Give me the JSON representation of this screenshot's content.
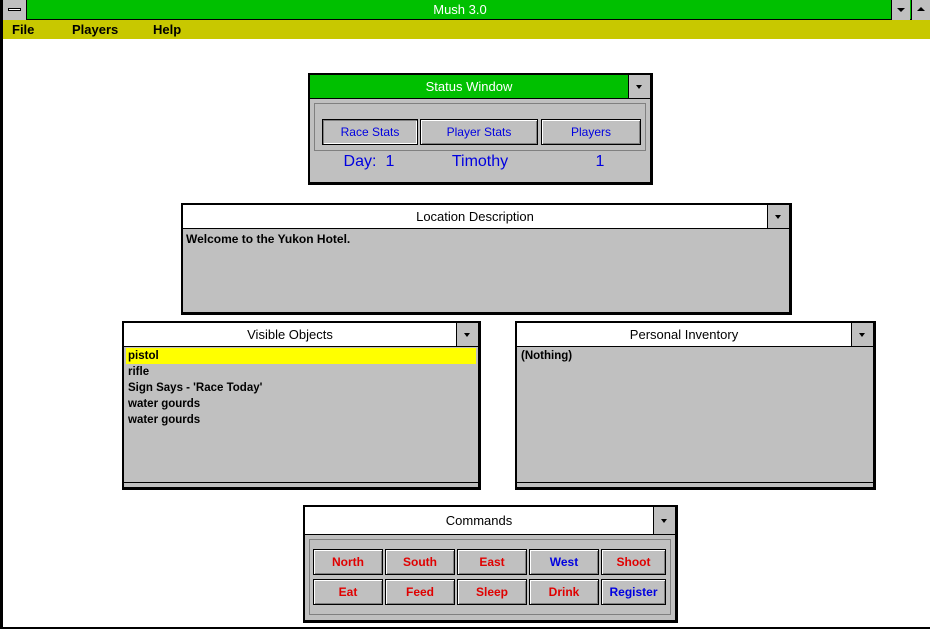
{
  "app": {
    "title": "Mush 3.0"
  },
  "menu": [
    {
      "label": "File"
    },
    {
      "label": "Players"
    },
    {
      "label": "Help"
    }
  ],
  "status_window": {
    "title": "Status Window",
    "tabs": [
      "Race Stats",
      "Player Stats",
      "Players"
    ],
    "day_label": "Day:",
    "day_value": "1",
    "player_name": "Timothy",
    "players_count": "1"
  },
  "location": {
    "title": "Location Description",
    "text": "Welcome to the Yukon Hotel."
  },
  "visible_objects": {
    "title": "Visible Objects",
    "items": [
      "pistol",
      "rifle",
      "Sign Says - 'Race Today'",
      "water gourds",
      "water gourds"
    ],
    "selected_index": 0
  },
  "inventory": {
    "title": "Personal Inventory",
    "items": [
      "(Nothing)"
    ]
  },
  "commands": {
    "title": "Commands",
    "row1": [
      "North",
      "South",
      "East",
      "West",
      "Shoot"
    ],
    "row2": [
      "Eat",
      "Feed",
      "Sleep",
      "Drink",
      "Register"
    ]
  },
  "colors": {
    "title_bar": "#00c000",
    "menu_bar": "#c8c800",
    "selection": "#ffff00",
    "command_red": "#e00000",
    "command_blue": "#0000e0"
  }
}
